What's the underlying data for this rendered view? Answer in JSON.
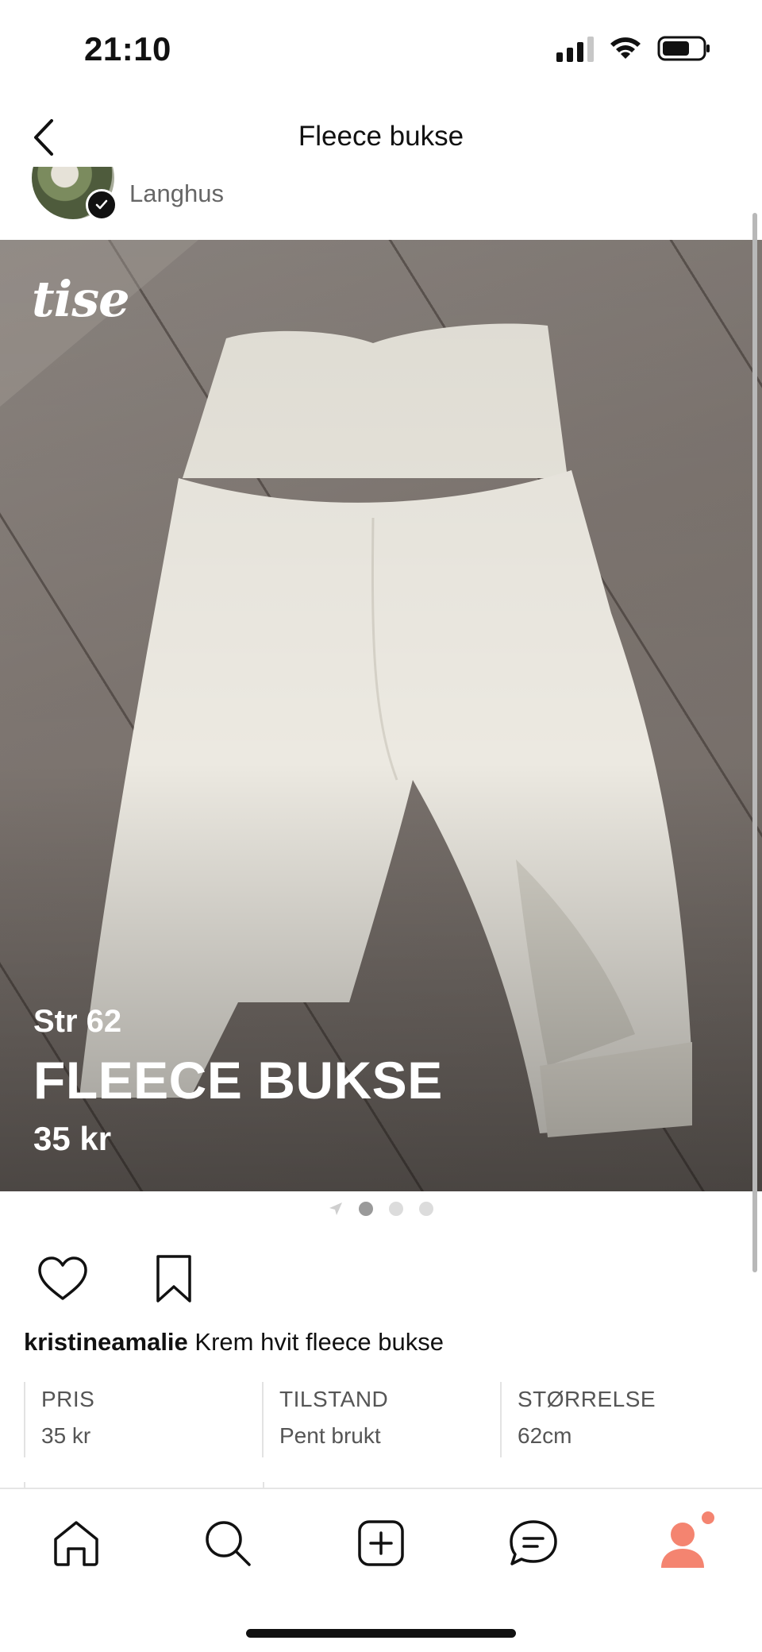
{
  "status_bar": {
    "time": "21:10"
  },
  "header": {
    "title": "Fleece bukse"
  },
  "seller": {
    "location": "Langhus"
  },
  "photo": {
    "brand": "tise",
    "overlay_size": "Str 62",
    "overlay_title": "FLEECE BUKSE",
    "overlay_price": "35 kr",
    "image_count": 3,
    "active_index": 0
  },
  "post": {
    "username": "kristineamalie",
    "description": "Krem hvit fleece bukse"
  },
  "details": [
    {
      "label": "PRIS",
      "value": "35 kr"
    },
    {
      "label": "TILSTAND",
      "value": "Pent brukt"
    },
    {
      "label": "STØRRELSE",
      "value": "62cm"
    }
  ],
  "tabbar": {
    "tabs": [
      "home-icon",
      "search-icon",
      "plus-square-icon",
      "chat-icon",
      "profile-icon"
    ],
    "accent": "#f48470"
  }
}
